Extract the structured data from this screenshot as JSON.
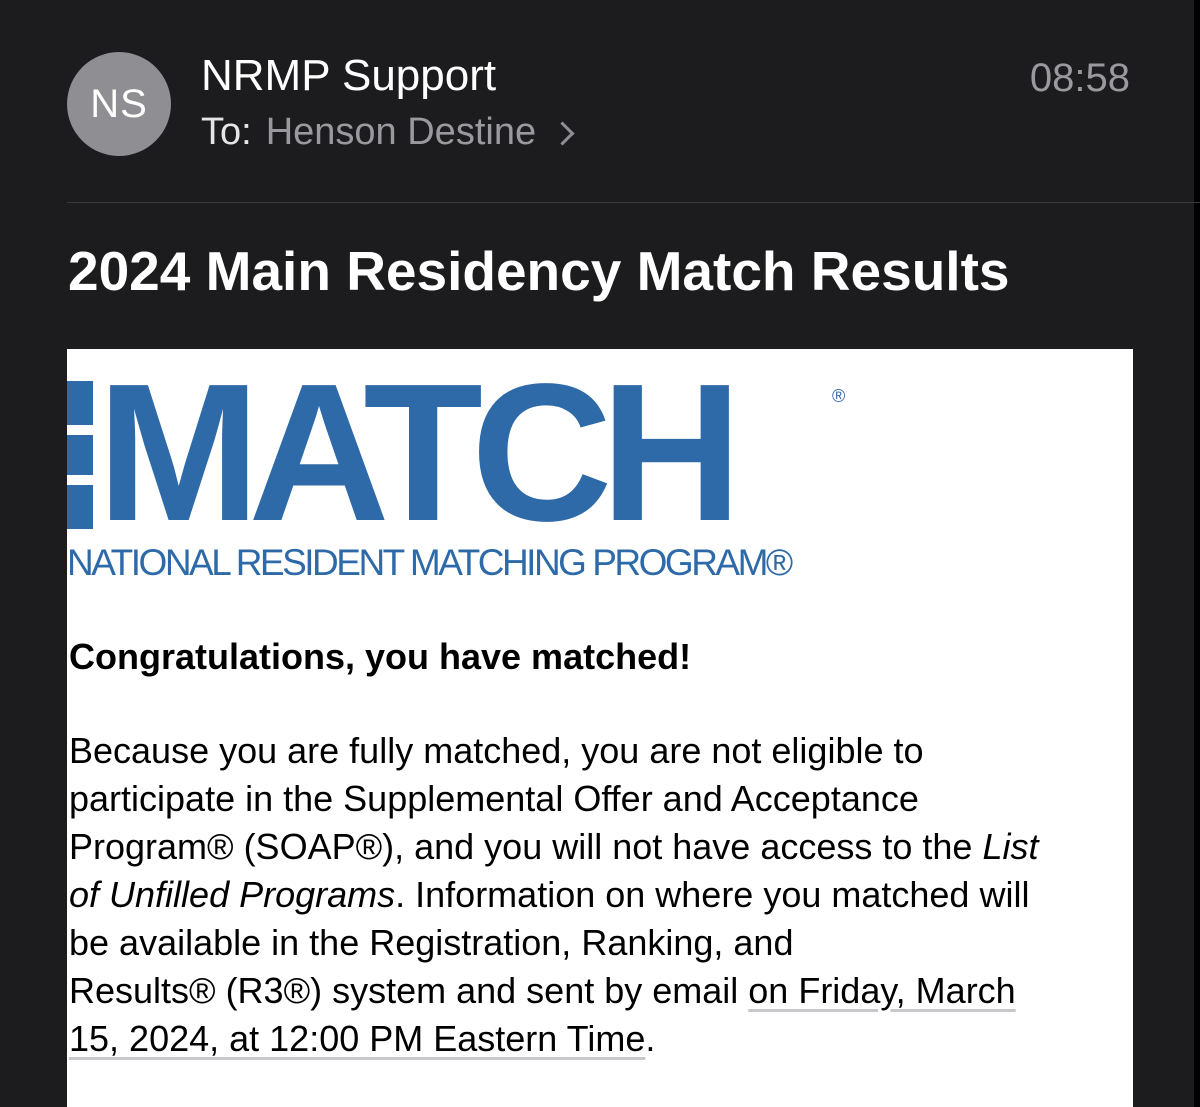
{
  "header": {
    "avatar_initials": "NS",
    "sender": "NRMP Support",
    "to_label": "To:",
    "recipient": "Henson Destine",
    "time": "08:58"
  },
  "subject": "2024 Main Residency Match Results",
  "logo": {
    "the": "THE",
    "match": "MATCH",
    "reg_mark": "®",
    "subtitle": "NATIONAL RESIDENT MATCHING PROGRAM®",
    "brand_color": "#2f6aa8"
  },
  "body": {
    "congrats": "Congratulations, you have matched!",
    "line1": "Because you are fully matched, you are not eligible to",
    "line2": "participate in the Supplemental Offer and Acceptance",
    "line3_a": "Program® (SOAP®), and you will not have access to the ",
    "line3_b": "List",
    "line4_a": "of Unfilled Programs",
    "line4_b": ". Information on where you matched will",
    "line5": "be available in the Registration, Ranking, and",
    "line6_a": "Results® (R3®) system and sent by email ",
    "line6_link": "on Friday, March",
    "line7_link": "15, 2024, at 12:00 PM Eastern Time",
    "line7_b": "."
  }
}
